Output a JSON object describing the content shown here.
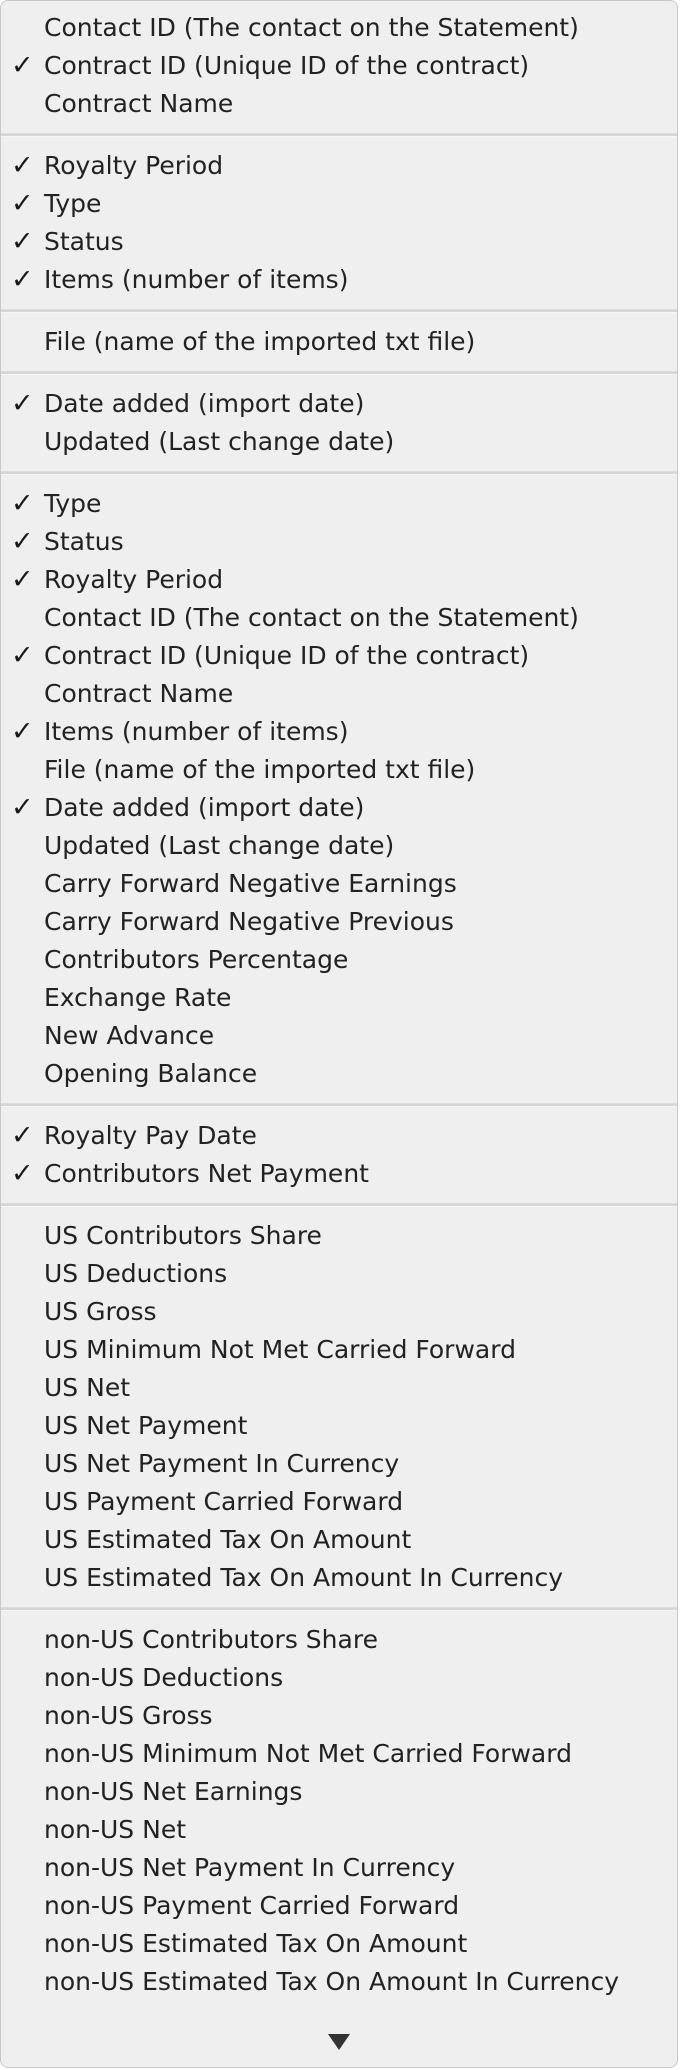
{
  "menu": {
    "check_glyph": "✓",
    "groups": [
      {
        "items": [
          {
            "label": "Contact ID (The contact on the Statement)",
            "checked": false
          },
          {
            "label": "Contract ID (Unique ID of the contract)",
            "checked": true
          },
          {
            "label": "Contract Name",
            "checked": false
          }
        ]
      },
      {
        "items": [
          {
            "label": "Royalty Period",
            "checked": true
          },
          {
            "label": "Type",
            "checked": true
          },
          {
            "label": "Status",
            "checked": true
          },
          {
            "label": "Items (number of items)",
            "checked": true
          }
        ]
      },
      {
        "items": [
          {
            "label": "File (name of the imported txt file)",
            "checked": false
          }
        ]
      },
      {
        "items": [
          {
            "label": "Date added (import date)",
            "checked": true
          },
          {
            "label": "Updated (Last change date)",
            "checked": false
          }
        ]
      },
      {
        "items": [
          {
            "label": "Type",
            "checked": true
          },
          {
            "label": "Status",
            "checked": true
          },
          {
            "label": "Royalty Period",
            "checked": true
          },
          {
            "label": "Contact ID (The contact on the Statement)",
            "checked": false
          },
          {
            "label": "Contract ID (Unique ID of the contract)",
            "checked": true
          },
          {
            "label": "Contract Name",
            "checked": false
          },
          {
            "label": "Items (number of items)",
            "checked": true
          },
          {
            "label": "File (name of the imported txt file)",
            "checked": false
          },
          {
            "label": "Date added (import date)",
            "checked": true
          },
          {
            "label": "Updated (Last change date)",
            "checked": false
          },
          {
            "label": "Carry Forward Negative Earnings",
            "checked": false
          },
          {
            "label": "Carry Forward Negative Previous",
            "checked": false
          },
          {
            "label": "Contributors Percentage",
            "checked": false
          },
          {
            "label": "Exchange Rate",
            "checked": false
          },
          {
            "label": "New Advance",
            "checked": false
          },
          {
            "label": "Opening Balance",
            "checked": false
          }
        ]
      },
      {
        "items": [
          {
            "label": "Royalty Pay Date",
            "checked": true
          },
          {
            "label": "Contributors Net Payment",
            "checked": true
          }
        ]
      },
      {
        "items": [
          {
            "label": "US Contributors Share",
            "checked": false
          },
          {
            "label": "US Deductions",
            "checked": false
          },
          {
            "label": "US Gross",
            "checked": false
          },
          {
            "label": "US Minimum Not Met Carried Forward",
            "checked": false
          },
          {
            "label": "US Net",
            "checked": false
          },
          {
            "label": "US Net Payment",
            "checked": false
          },
          {
            "label": "US Net Payment In Currency",
            "checked": false
          },
          {
            "label": "US Payment Carried Forward",
            "checked": false
          },
          {
            "label": "US Estimated Tax On Amount",
            "checked": false
          },
          {
            "label": "US Estimated Tax On Amount In Currency",
            "checked": false
          }
        ]
      },
      {
        "items": [
          {
            "label": "non-US Contributors Share",
            "checked": false
          },
          {
            "label": "non-US Deductions",
            "checked": false
          },
          {
            "label": "non-US Gross",
            "checked": false
          },
          {
            "label": "non-US Minimum Not Met Carried Forward",
            "checked": false
          },
          {
            "label": "non-US Net Earnings",
            "checked": false
          },
          {
            "label": "non-US Net",
            "checked": false
          },
          {
            "label": "non-US Net Payment In Currency",
            "checked": false
          },
          {
            "label": "non-US Payment Carried Forward",
            "checked": false
          },
          {
            "label": "non-US Estimated Tax On Amount",
            "checked": false
          },
          {
            "label": "non-US Estimated Tax On Amount In Currency",
            "checked": false
          }
        ]
      }
    ],
    "scroll_down_icon": "down-triangle"
  }
}
